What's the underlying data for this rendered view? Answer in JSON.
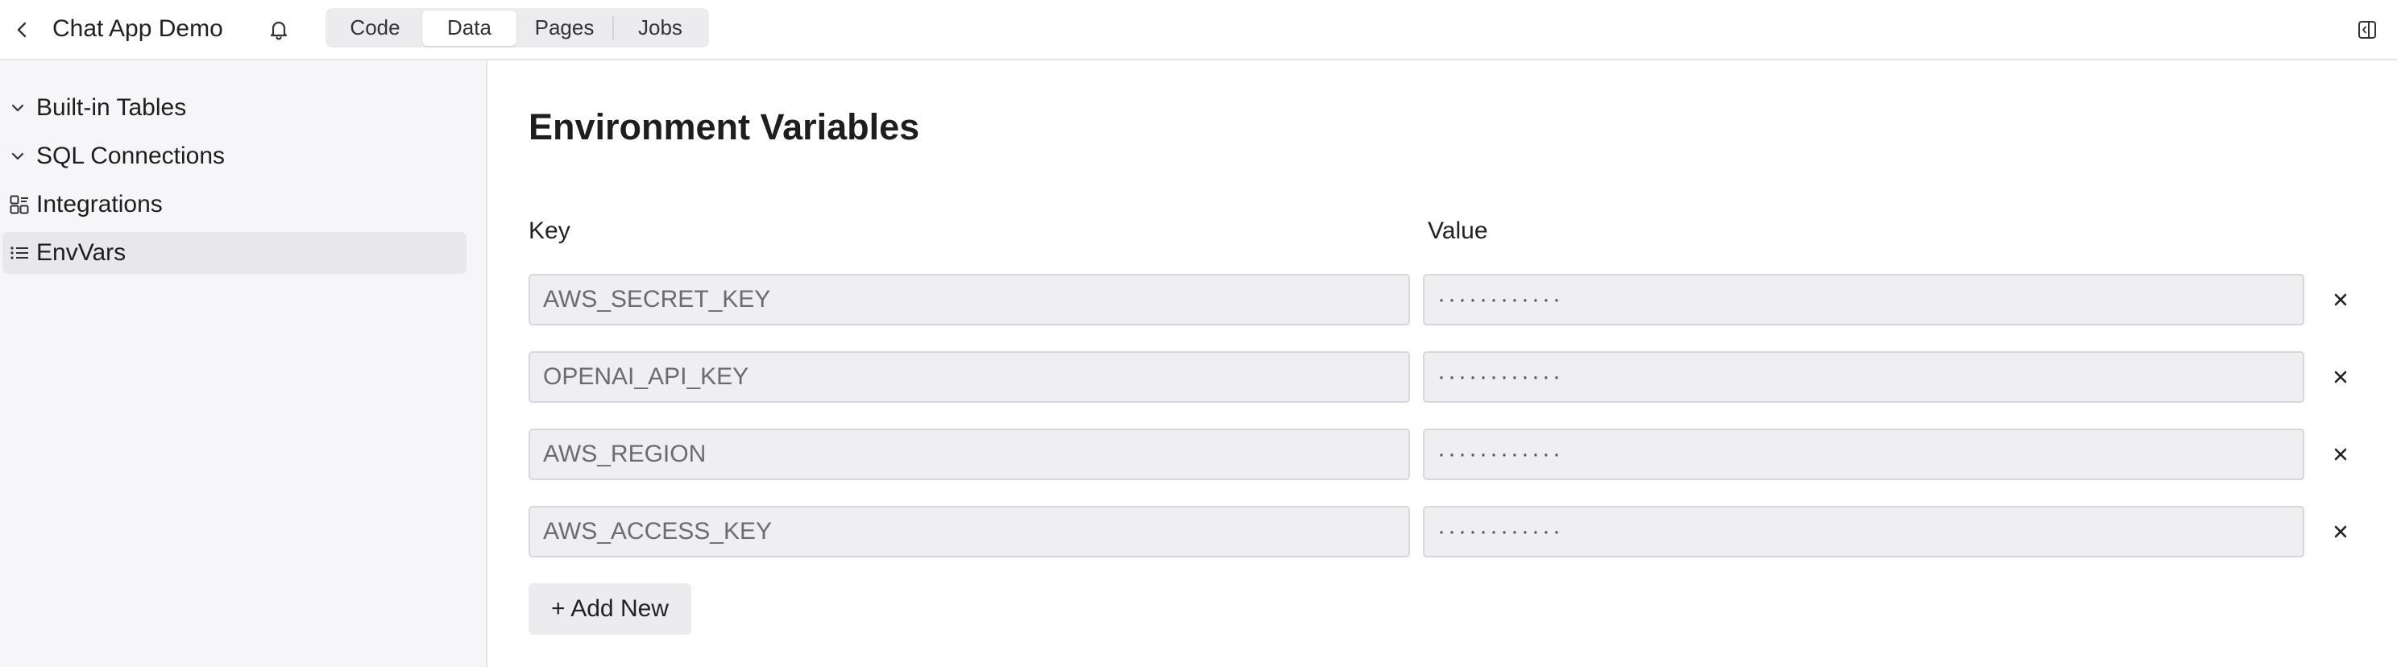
{
  "header": {
    "back_icon": "chevron-left-icon",
    "title": "Chat App Demo",
    "bell_icon": "bell-icon",
    "tabs": [
      {
        "label": "Code"
      },
      {
        "label": "Data",
        "selected": true
      },
      {
        "label": "Pages"
      },
      {
        "label": "Jobs"
      }
    ],
    "panel_toggle_icon": "sidebar-panel-icon"
  },
  "sidebar": {
    "items": [
      {
        "label": "Built-in Tables",
        "icon": "chevron-down-icon"
      },
      {
        "label": "SQL Connections",
        "icon": "chevron-down-icon"
      },
      {
        "label": "Integrations",
        "icon": "integrations-icon"
      },
      {
        "label": "EnvVars",
        "icon": "list-icon",
        "active": true
      }
    ]
  },
  "main": {
    "title": "Environment Variables",
    "key_header": "Key",
    "value_header": "Value",
    "rows": [
      {
        "key": "AWS_SECRET_KEY",
        "value": "············"
      },
      {
        "key": "OPENAI_API_KEY",
        "value": "············"
      },
      {
        "key": "AWS_REGION",
        "value": "············"
      },
      {
        "key": "AWS_ACCESS_KEY",
        "value": "············"
      }
    ],
    "delete_icon": "close-icon",
    "add_button": "+ Add New"
  }
}
